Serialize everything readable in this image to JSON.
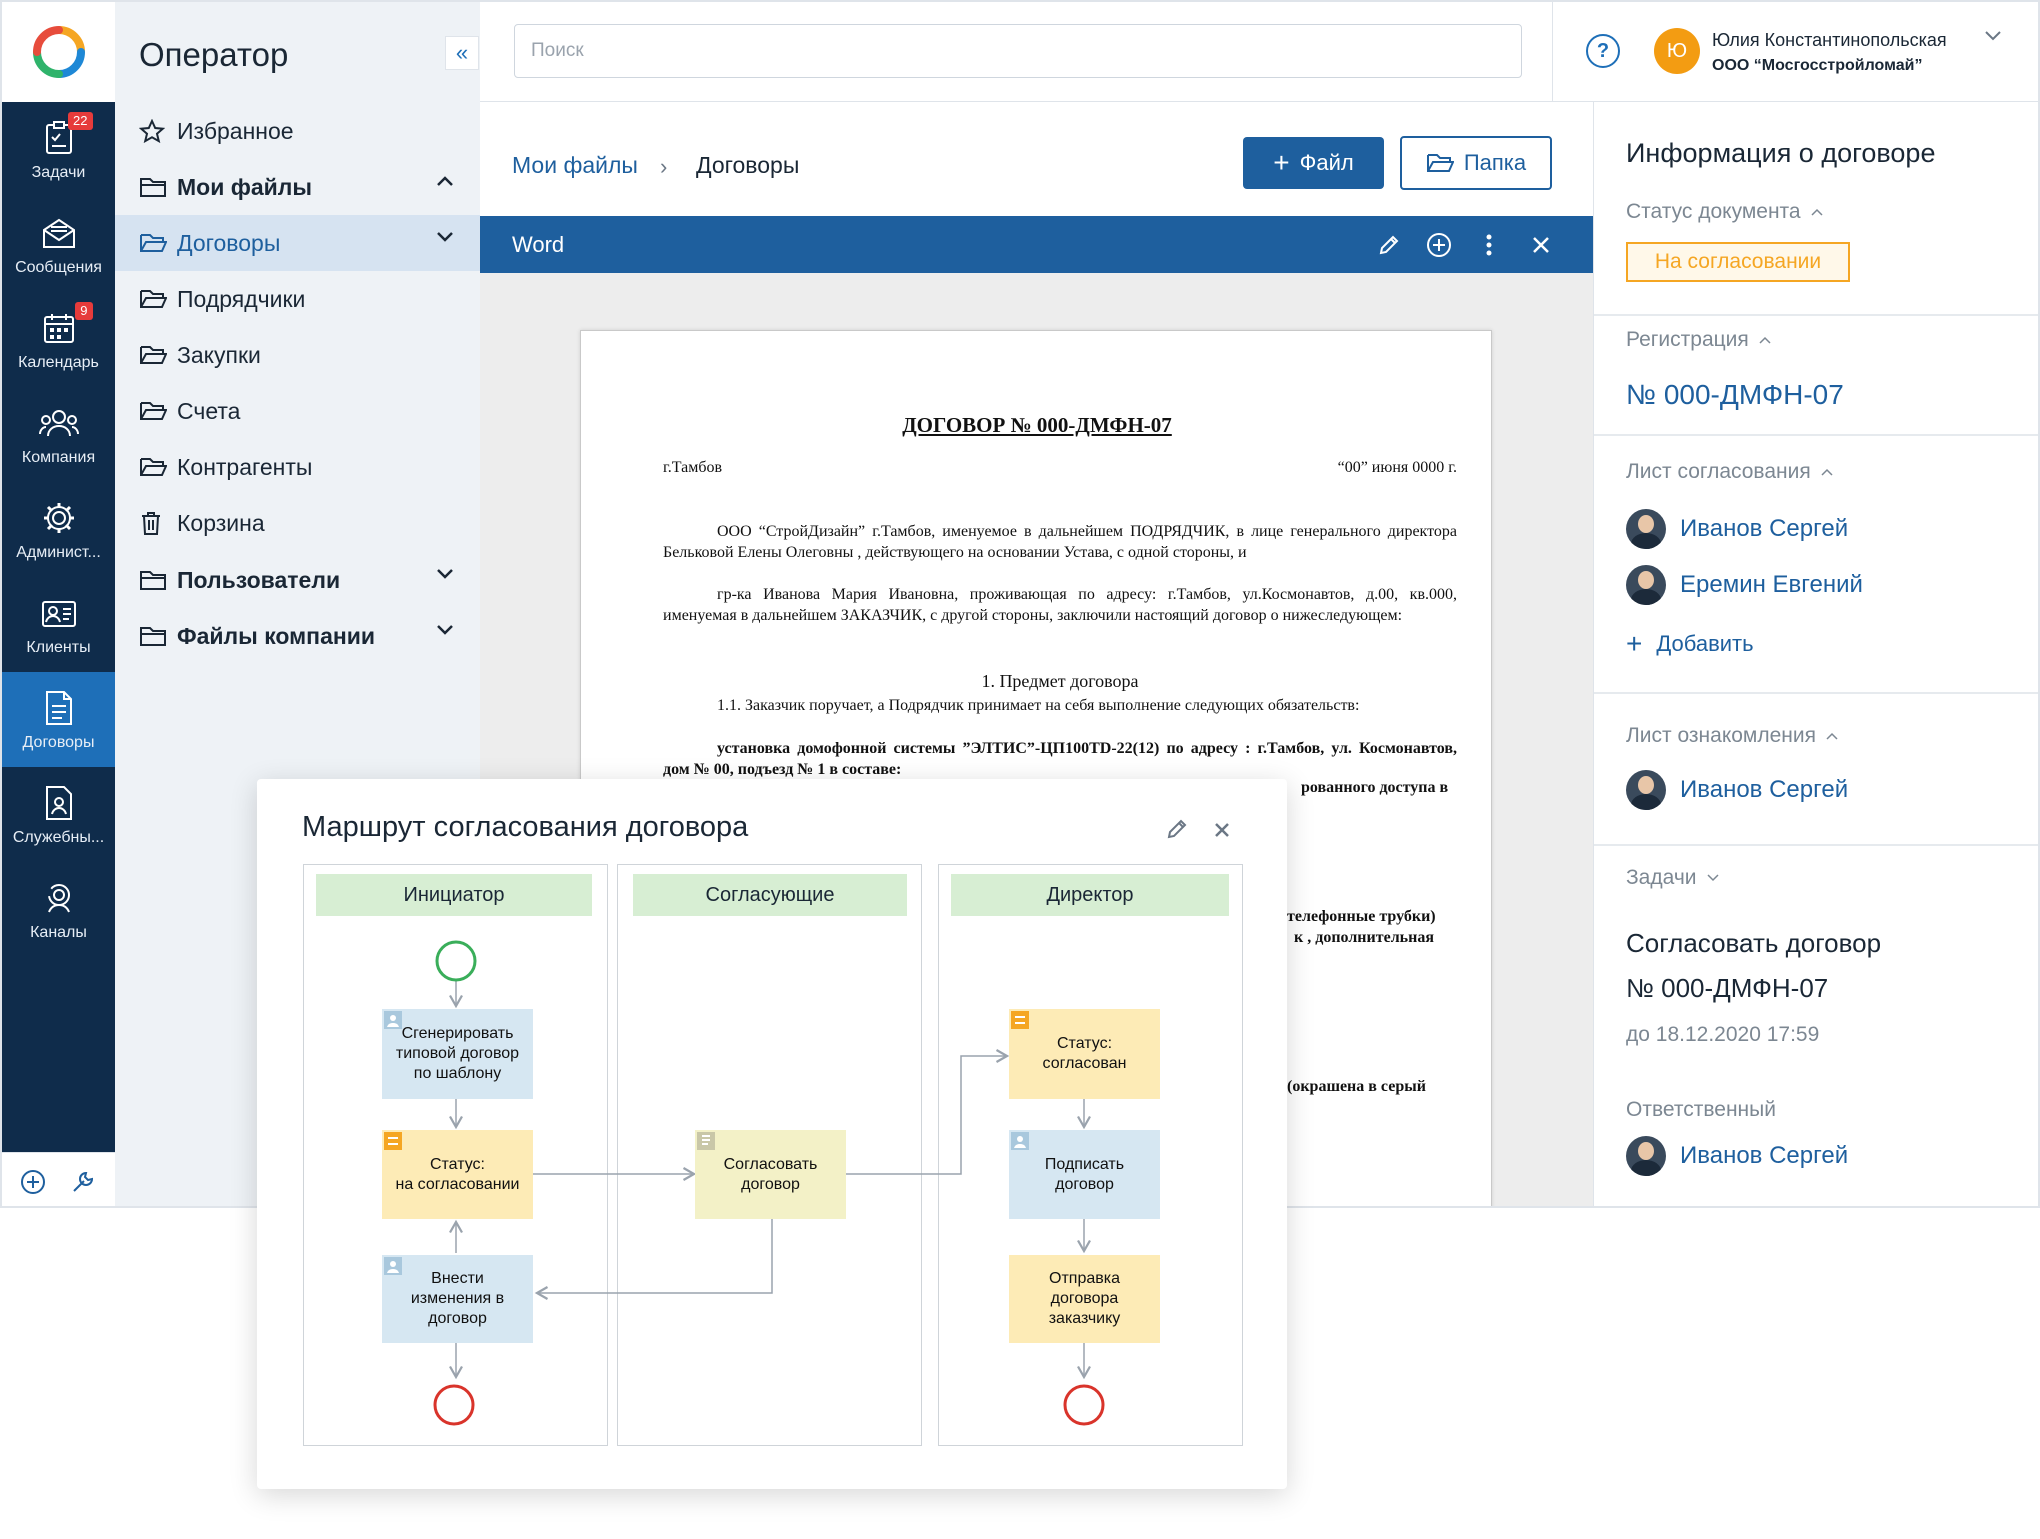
{
  "rail": {
    "items": [
      {
        "label": "Задачи",
        "badge": "22",
        "icon": "tasks-icon"
      },
      {
        "label": "Сообщения",
        "badge": "",
        "icon": "messages-icon"
      },
      {
        "label": "Календарь",
        "badge": "9",
        "icon": "calendar-icon"
      },
      {
        "label": "Компания",
        "badge": "",
        "icon": "company-icon"
      },
      {
        "label": "Админист...",
        "badge": "",
        "icon": "admin-gear-icon"
      },
      {
        "label": "Клиенты",
        "badge": "",
        "icon": "clients-icon"
      },
      {
        "label": "Договоры",
        "badge": "",
        "icon": "contracts-icon",
        "active": true
      },
      {
        "label": "Служебны...",
        "badge": "",
        "icon": "service-icon"
      },
      {
        "label": "Каналы",
        "badge": "",
        "icon": "channels-icon"
      }
    ]
  },
  "sidebar": {
    "title": "Оператор",
    "items": [
      {
        "label": "Избранное",
        "icon": "star-icon"
      },
      {
        "label": "Мои файлы",
        "icon": "folder-icon",
        "chevron": "up"
      },
      {
        "label": "Договоры",
        "icon": "folder-open-icon",
        "chevron": "down",
        "active": true
      },
      {
        "label": "Подрядчики",
        "icon": "folder-open-icon"
      },
      {
        "label": "Закупки",
        "icon": "folder-open-icon"
      },
      {
        "label": "Счета",
        "icon": "folder-open-icon"
      },
      {
        "label": "Контрагенты",
        "icon": "folder-open-icon"
      },
      {
        "label": "Корзина",
        "icon": "trash-icon"
      },
      {
        "label": "Пользователи",
        "icon": "folder-icon",
        "chevron": "down"
      },
      {
        "label": "Файлы компании",
        "icon": "folder-icon",
        "chevron": "down"
      }
    ]
  },
  "topbar": {
    "search_placeholder": "Поиск",
    "user_initial": "Ю",
    "user_name": "Юлия Константинопольская",
    "user_org": "ООО “Мосгосстройломай”"
  },
  "content": {
    "breadcrumb_root": "Мои файлы",
    "breadcrumb_sep": "›",
    "breadcrumb_current": "Договоры",
    "file_button": "Файл",
    "folder_button": "Папка",
    "viewer_title": "Word"
  },
  "document": {
    "title": "ДОГОВОР № 000-ДМФН-07",
    "city": "г.Тамбов",
    "date": "“00” июня   0000 г.",
    "para1": "ООО “СтройДизайн” г.Тамбов, именуемое в дальнейшем ПОДРЯДЧИК, в лице генерального директора Бельковой Елены Олеговны , действующего на основании Устава, с одной стороны, и",
    "para2": "гр-ка Иванова Мария Ивановна, проживающая по адресу: г.Тамбов, ул.Космонавтов, д.00, кв.000, именуемая в дальнейшем ЗАКАЗЧИК, с другой стороны, заключили настоящий договор о нижеследующем:",
    "section1": "1. Предмет договора",
    "para3": "1.1. Заказчик поручает, а Подрядчик принимает на себя выполнение следующих обязательств:",
    "para4": "установка домофонной системы ”ЭЛТИС”-ЦП100TD-22(12) по адресу : г.Тамбов, ул. Космонавтов, дом  № 00, подъезд № 1 в составе:",
    "frag1": "рованного доступа в",
    "frag2": "телефонные трубки)",
    "frag3": "к , дополнительная",
    "frag4": "(окрашена в серый"
  },
  "info": {
    "title": "Информация о договоре",
    "status_label": "Статус документа",
    "status_value": "На согласовании",
    "registration_label": "Регистрация",
    "registration_value": "№ 000-ДМФН-07",
    "approval_label": "Лист согласования",
    "approvers": [
      "Иванов Сергей",
      "Еремин Евгений"
    ],
    "add_label": "Добавить",
    "review_label": "Лист ознакомления",
    "reviewers": [
      "Иванов Сергей"
    ],
    "tasks_label": "Задачи",
    "task_title_1": "Согласовать договор",
    "task_title_2": "№ 000-ДМФН-07",
    "task_due": "до 18.12.2020  17:59",
    "responsible_label": "Ответственный",
    "responsible": "Иванов Сергей"
  },
  "route": {
    "title": "Маршрут согласования договора",
    "lanes": [
      "Инициатор",
      "Согласующие",
      "Директор"
    ],
    "nodes": {
      "generate": "Сгенерировать типовой договор по шаблону",
      "status_review": "Статус:\nна согласовании",
      "edit": "Внести изменения в договор",
      "approve": "Согласовать договор",
      "status_approved": "Статус:\nсогласован",
      "sign": "Подписать договор",
      "send": "Отправка договора заказчику"
    }
  },
  "colors": {
    "rail_bg": "#0f2c4b",
    "accent": "#1e5f9e",
    "rail_active": "#1e6fb8",
    "status_orange": "#f5a623",
    "lane_header": "#d7eed3"
  }
}
